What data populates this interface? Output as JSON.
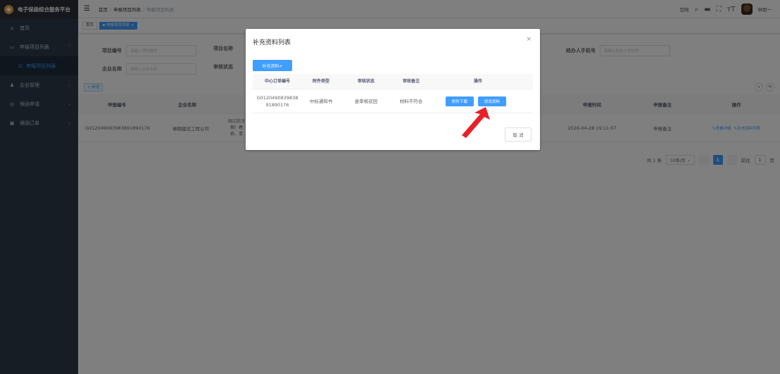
{
  "app": {
    "title": "电子保函综合服务平台"
  },
  "sidebar": {
    "items": [
      {
        "label": "首页",
        "icon": "home-icon"
      },
      {
        "label": "申报项目列表",
        "icon": "list-icon"
      },
      {
        "label": "申报项目列表",
        "icon": "document-icon",
        "active": true
      },
      {
        "label": "企业管理",
        "icon": "user-icon"
      },
      {
        "label": "保函申请",
        "icon": "form-icon"
      },
      {
        "label": "保函订单",
        "icon": "order-icon"
      }
    ]
  },
  "navbar": {
    "breadcrumb": [
      "首页",
      "申报项目列表",
      "申报项目列表"
    ],
    "right_text": "官网",
    "username": "林丽一"
  },
  "tags": {
    "home": "首页",
    "current": "申报项目列表"
  },
  "search": {
    "project_no_label": "项目编号",
    "project_no_placeholder": "请输入项目编号",
    "project_name_label": "项目名称",
    "company_label": "企业名称",
    "company_placeholder": "请输入企业名称",
    "audit_label": "审核状态",
    "phone_label": "经办人手机号",
    "phone_placeholder": "请输入经办人手机号"
  },
  "toolbar": {
    "add_label": "+ 新增"
  },
  "table": {
    "headers": [
      "申报编号",
      "企业名称",
      "申报时间",
      "申报备注",
      "操作"
    ],
    "row": {
      "no": "G0120490839838918901​76",
      "company": "琳璐建设工程公司",
      "project_lines": [
        "闽江防汛",
        "期）春",
        "桥、单"
      ],
      "time": "2026-04-28 19:11:07",
      "remark": "申报备注",
      "action_view": "查看详情",
      "action_supplement": "补充资料列表"
    }
  },
  "pagination": {
    "total": "共 1 条",
    "page_size": "10条/页",
    "current": "1",
    "goto_label": "前往",
    "goto_value": "1",
    "page_unit": "页"
  },
  "dialog": {
    "title": "补充资料列表",
    "add_button": "补充资料+",
    "headers": [
      "中心订单编号",
      "附件类型",
      "审核状态",
      "审核备注",
      "操作"
    ],
    "row": {
      "order_no_line1": "G0120490839838",
      "order_no_line2": "91890176",
      "type": "中标通知书",
      "status": "县审核驳回",
      "remark": "材料不符合",
      "download_label": "附件下载",
      "edit_label": "修改资料"
    },
    "cancel_label": "取 消"
  },
  "colors": {
    "primary": "#409eff",
    "sidebar": "#2d3a4b",
    "annotation_arrow": "#e8202a"
  }
}
